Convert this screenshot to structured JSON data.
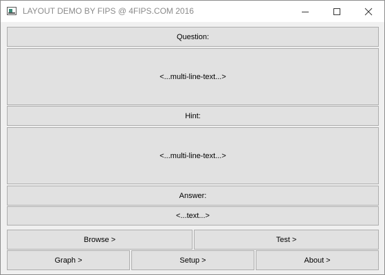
{
  "window": {
    "title": "LAYOUT DEMO BY FIPS @ 4FIPS.COM 2016",
    "icon": "app-window-icon",
    "controls": [
      "minimize-icon",
      "maximize-icon",
      "close-icon"
    ]
  },
  "form": {
    "question_label": "Question:",
    "question_text": "<...multi-line-text...>",
    "hint_label": "Hint:",
    "hint_text": "<...multi-line-text...>",
    "answer_label": "Answer:",
    "answer_text": "<...text...>"
  },
  "buttons": {
    "browse": "Browse >",
    "test": "Test >",
    "graph": "Graph >",
    "setup": "Setup >",
    "about": "About >"
  }
}
